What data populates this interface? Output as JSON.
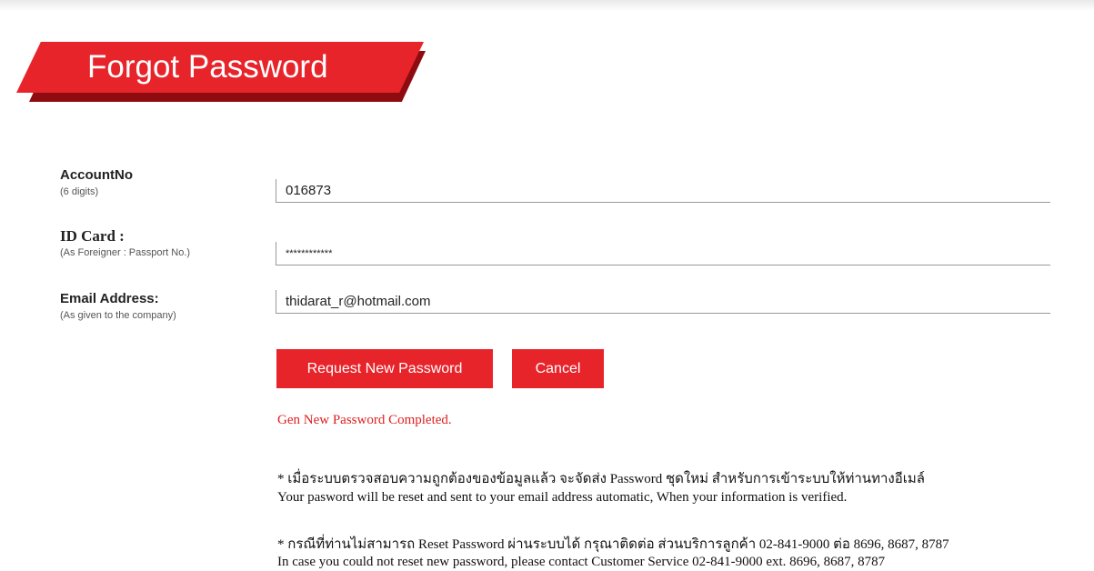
{
  "page": {
    "title": "Forgot Password"
  },
  "form": {
    "account": {
      "label": "AccountNo",
      "hint": "(6 digits)",
      "value": "016873"
    },
    "idcard": {
      "label": "ID Card :",
      "hint": "(As Foreigner : Passport No.)",
      "value": "************"
    },
    "email": {
      "label": "Email Address:",
      "hint": "(As given to the company)",
      "value": "thidarat_r@hotmail.com"
    }
  },
  "buttons": {
    "request_label": "Request New Password",
    "cancel_label": "Cancel"
  },
  "status": {
    "message": "Gen New Password Completed."
  },
  "notes": {
    "note1_th": "* เมื่อระบบตรวจสอบความถูกต้องของข้อมูลแล้ว จะจัดส่ง Password ชุดใหม่ สำหรับการเข้าระบบให้ท่านทางอีเมล์",
    "note1_en": "Your pasword will be reset and sent to your email address automatic, When your information is verified.",
    "note2_th": "* กรณีที่ท่านไม่สามารถ Reset Password ผ่านระบบได้ กรุณาติดต่อ ส่วนบริการลูกค้า 02-841-9000 ต่อ 8696, 8687, 8787",
    "note2_en": "In case you could not reset new password, please contact Customer Service 02-841-9000 ext. 8696, 8687, 8787"
  },
  "colors": {
    "brand_red": "#e8242b",
    "brand_dark_red": "#8e0b10",
    "status_red": "#e02020"
  }
}
